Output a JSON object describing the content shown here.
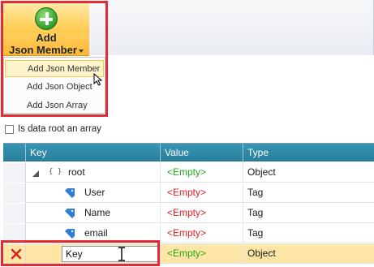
{
  "ribbon": {
    "add_button": {
      "line1": "Add",
      "line2": "Json Member",
      "icon": "plus-icon"
    }
  },
  "dropdown_menu": {
    "items": [
      {
        "label": "Add Json Member"
      },
      {
        "label": "Add Json Object"
      },
      {
        "label": "Add Json Array"
      }
    ]
  },
  "options": {
    "root_array_label": "Is data root an array",
    "root_array_checked": false
  },
  "grid": {
    "columns": [
      "Key",
      "Value",
      "Type"
    ],
    "rows": [
      {
        "key": "root",
        "value": "<Empty>",
        "type": "Object"
      },
      {
        "key": "User",
        "value": "<Empty>",
        "type": "Tag"
      },
      {
        "key": "Name",
        "value": "<Empty>",
        "type": "Tag"
      },
      {
        "key": "email",
        "value": "<Empty>",
        "type": "Tag"
      },
      {
        "key": "Key",
        "value": "<Empty>",
        "type": "Object"
      }
    ]
  },
  "colors": {
    "highlight_border": "#e32b36",
    "header_bg": "#2f8aa7",
    "empty_red": "#e31b25",
    "empty_green": "#22a51d",
    "edit_row_bg": "#fde6a5"
  }
}
